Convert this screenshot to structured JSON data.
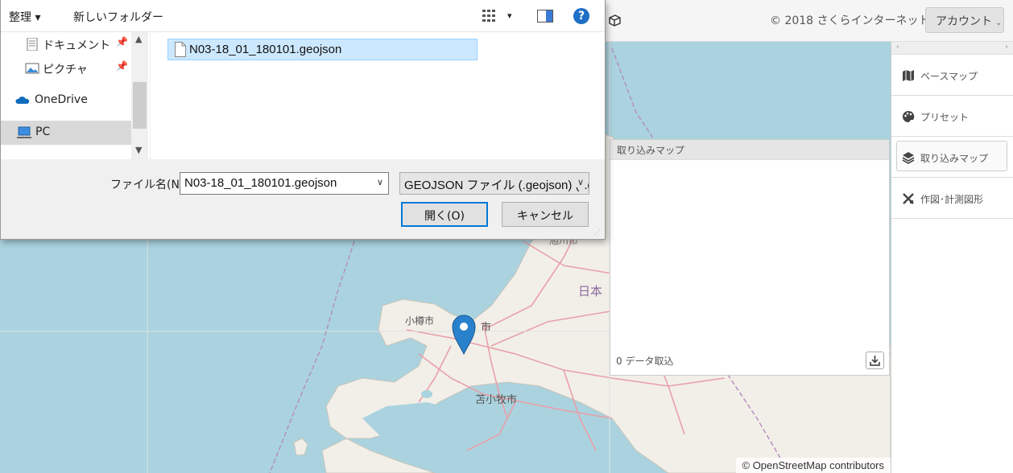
{
  "dialog": {
    "toolbar": {
      "organize": "整理 ▾",
      "new_folder": "新しいフォルダー",
      "view_icon": "view-icon",
      "view_dropdown": "▾",
      "pane_icon": "preview-pane-icon",
      "help": "?"
    },
    "nav": [
      {
        "label": "ドキュメント",
        "icon": "documents-icon",
        "pinned": true
      },
      {
        "label": "ピクチャ",
        "icon": "pictures-icon",
        "pinned": true
      },
      {
        "label": "OneDrive",
        "icon": "onedrive-icon",
        "pinned": false
      },
      {
        "label": "PC",
        "icon": "pc-icon",
        "pinned": false,
        "selected": true
      }
    ],
    "files": [
      {
        "name": "N03-18_01_180101.geojson",
        "icon": "file-icon",
        "selected": true
      }
    ],
    "filename_label": "ファイル名(N):",
    "filename_value": "N03-18_01_180101.geojson",
    "filetype_value": "GEOJSON ファイル (.geojson) (*.g",
    "open_button": "開く(O)",
    "cancel_button": "キャンセル"
  },
  "app": {
    "copyright": "© 2018 さくらインターネット",
    "account": "アカウント",
    "sidebar": [
      {
        "label": "ベースマップ",
        "icon": "map-icon"
      },
      {
        "label": "プリセット",
        "icon": "palette-icon"
      },
      {
        "label": "取り込みマップ",
        "icon": "layers-icon",
        "active": true
      },
      {
        "label": "作図･計測図形",
        "icon": "draw-tools-icon"
      }
    ],
    "import_panel": {
      "header": "取り込みマップ",
      "count": "0 データ取込"
    }
  },
  "map": {
    "attribution": "© OpenStreetMap contributors",
    "labels": {
      "otaru": "小樽市",
      "sapporo_partial": "市",
      "tomakomai": "苫小牧市",
      "japan": "日本",
      "asahikawa_partial": "旭川市"
    },
    "colors": {
      "sea": "#aad3df",
      "land": "#f2efe9",
      "road": "#e8a0a8",
      "border": "#b48cc0",
      "marker": "#2a81cb"
    }
  }
}
